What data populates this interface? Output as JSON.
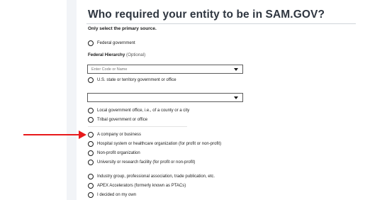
{
  "page": {
    "title": "Who required your entity to be in SAM.GOV?",
    "subtitle": "Only select the primary source."
  },
  "options": {
    "federal": "Federal government",
    "state": "U.S. state or territory government or office",
    "local": "Local government office, i.e., of a county or a city",
    "tribal": "Tribal government or office",
    "company": "A company or business",
    "hospital": "Hospital system or healthcare organization (for profit or non-profit)",
    "nonprofit": "Non-profit organization",
    "university": "University or research facility (for profit or non-profit)",
    "industry": "Industry group, professional association, trade publication, etc.",
    "apex": "APEX Accelerators (formerly known as PTACs)",
    "self": "I decided on my own"
  },
  "federal_hierarchy": {
    "label": "Federal Hierarchy",
    "optional": "(Optional)",
    "placeholder": "Enter Code or Name"
  },
  "state_select": {
    "value": ""
  },
  "annotation": {
    "arrow_color": "#e8191b",
    "points_to": "A company or business"
  },
  "colors": {
    "title": "#2f3640",
    "arrow": "#e8191b"
  }
}
